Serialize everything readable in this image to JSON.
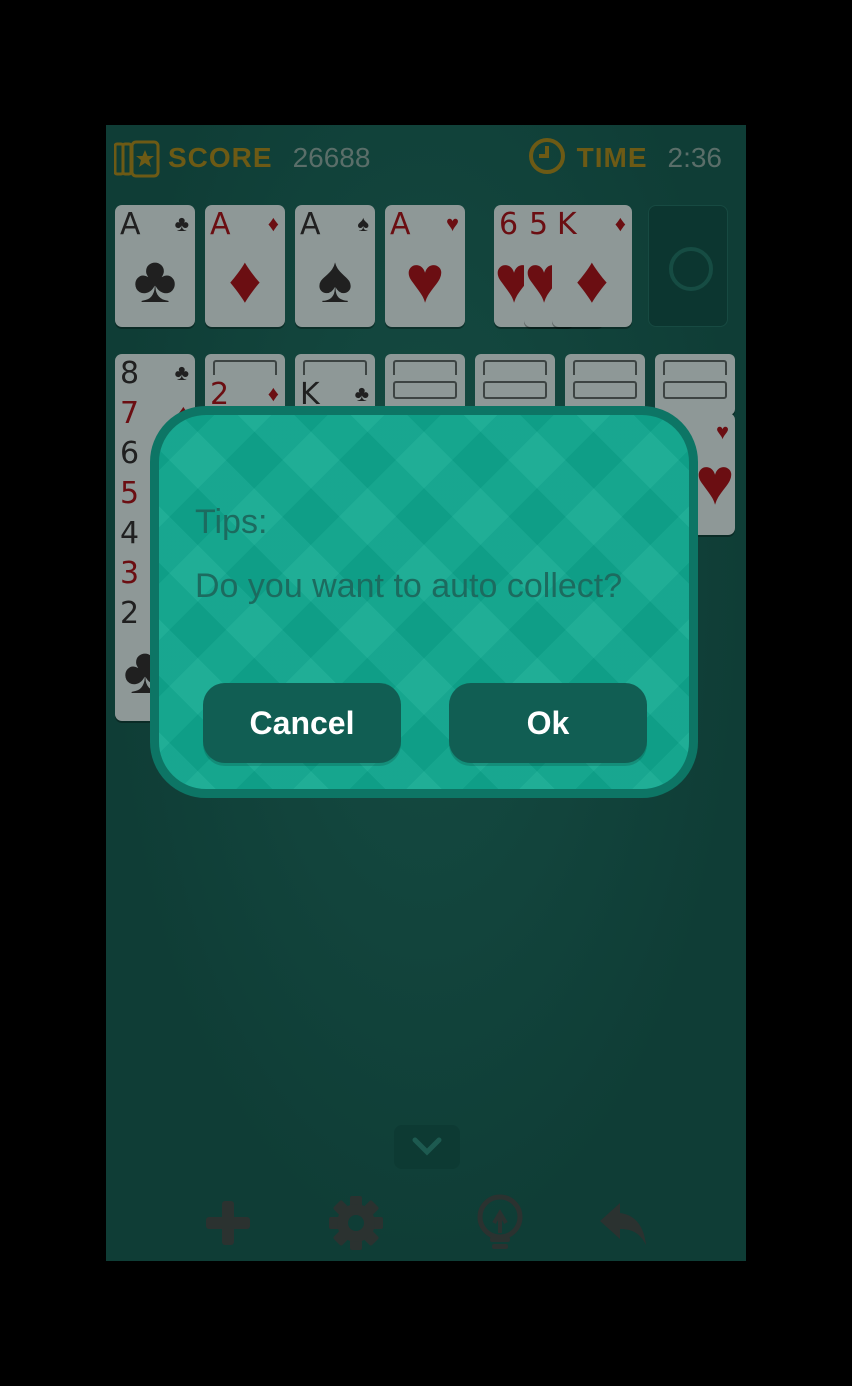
{
  "hud": {
    "score_label": "SCORE",
    "score_value": "26688",
    "time_label": "TIME",
    "time_value": "2:36"
  },
  "foundations": [
    {
      "rank": "A",
      "suit": "♣",
      "color": "black"
    },
    {
      "rank": "A",
      "suit": "♦",
      "color": "red"
    },
    {
      "rank": "A",
      "suit": "♠",
      "color": "black"
    },
    {
      "rank": "A",
      "suit": "♥",
      "color": "red"
    }
  ],
  "waste": [
    {
      "rank": "6",
      "suit": "♥",
      "color": "red"
    },
    {
      "rank": "5",
      "suit": "♥",
      "color": "red"
    },
    {
      "rank": "K",
      "suit": "♦",
      "color": "red"
    }
  ],
  "tableau": {
    "col1": [
      {
        "rank": "8",
        "suit": "♣",
        "color": "black"
      },
      {
        "rank": "7",
        "suit": "♦",
        "color": "red"
      },
      {
        "rank": "6",
        "suit": "",
        "color": "black"
      },
      {
        "rank": "5",
        "suit": "",
        "color": "red"
      },
      {
        "rank": "4",
        "suit": "",
        "color": "black"
      },
      {
        "rank": "3",
        "suit": "",
        "color": "red"
      },
      {
        "rank": "2",
        "suit": "♣",
        "color": "black"
      }
    ],
    "col2": {
      "rank": "2",
      "suit": "♦",
      "color": "red"
    },
    "col3": {
      "rank": "K",
      "suit": "♣",
      "color": "black"
    },
    "col7": {
      "rank": "",
      "suit": "♥",
      "color": "red"
    }
  },
  "dialog": {
    "title": "Tips:",
    "message": "Do you want to auto collect?",
    "cancel_label": "Cancel",
    "ok_label": "Ok"
  },
  "toolbar": {
    "icons": [
      "plus-icon",
      "gear-icon",
      "lightbulb-icon",
      "undo-icon"
    ]
  },
  "colors": {
    "overlay_felt": "#0f3d36",
    "dialog_bg": "#0fa88f",
    "dialog_border": "#0d7565",
    "button_bg": "#115e53",
    "hud_label": "#6d5a15"
  }
}
